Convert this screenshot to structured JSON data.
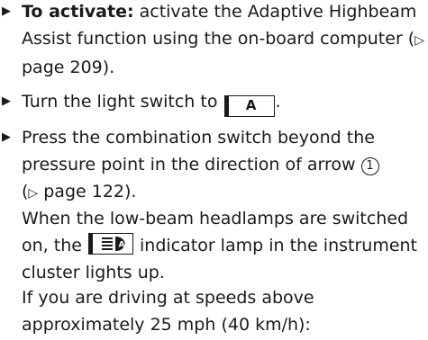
{
  "steps": [
    {
      "lead": "To activate:",
      "text_a": " activate the Adaptive Highbeam Assist function using the on-board computer (",
      "ref_arrow": "▷",
      "text_b": " page 209)."
    },
    {
      "text_a": "Turn the light switch to ",
      "key": "A",
      "text_b": "."
    },
    {
      "text_a": "Press the combination switch beyond the pressure point in the direction of arrow ",
      "circled": "1",
      "ref_open": " (",
      "ref_arrow": "▷",
      "text_b": " page 122)."
    }
  ],
  "para1": {
    "text_a": "When the low-beam headlamps are switched on, the ",
    "lamp_icon": "adaptive-highbeam-indicator-icon",
    "text_b": " indicator lamp in the instrument cluster lights up."
  },
  "para2": {
    "text": "If you are driving at speeds above approximately 25 mph (40 km/h):"
  }
}
